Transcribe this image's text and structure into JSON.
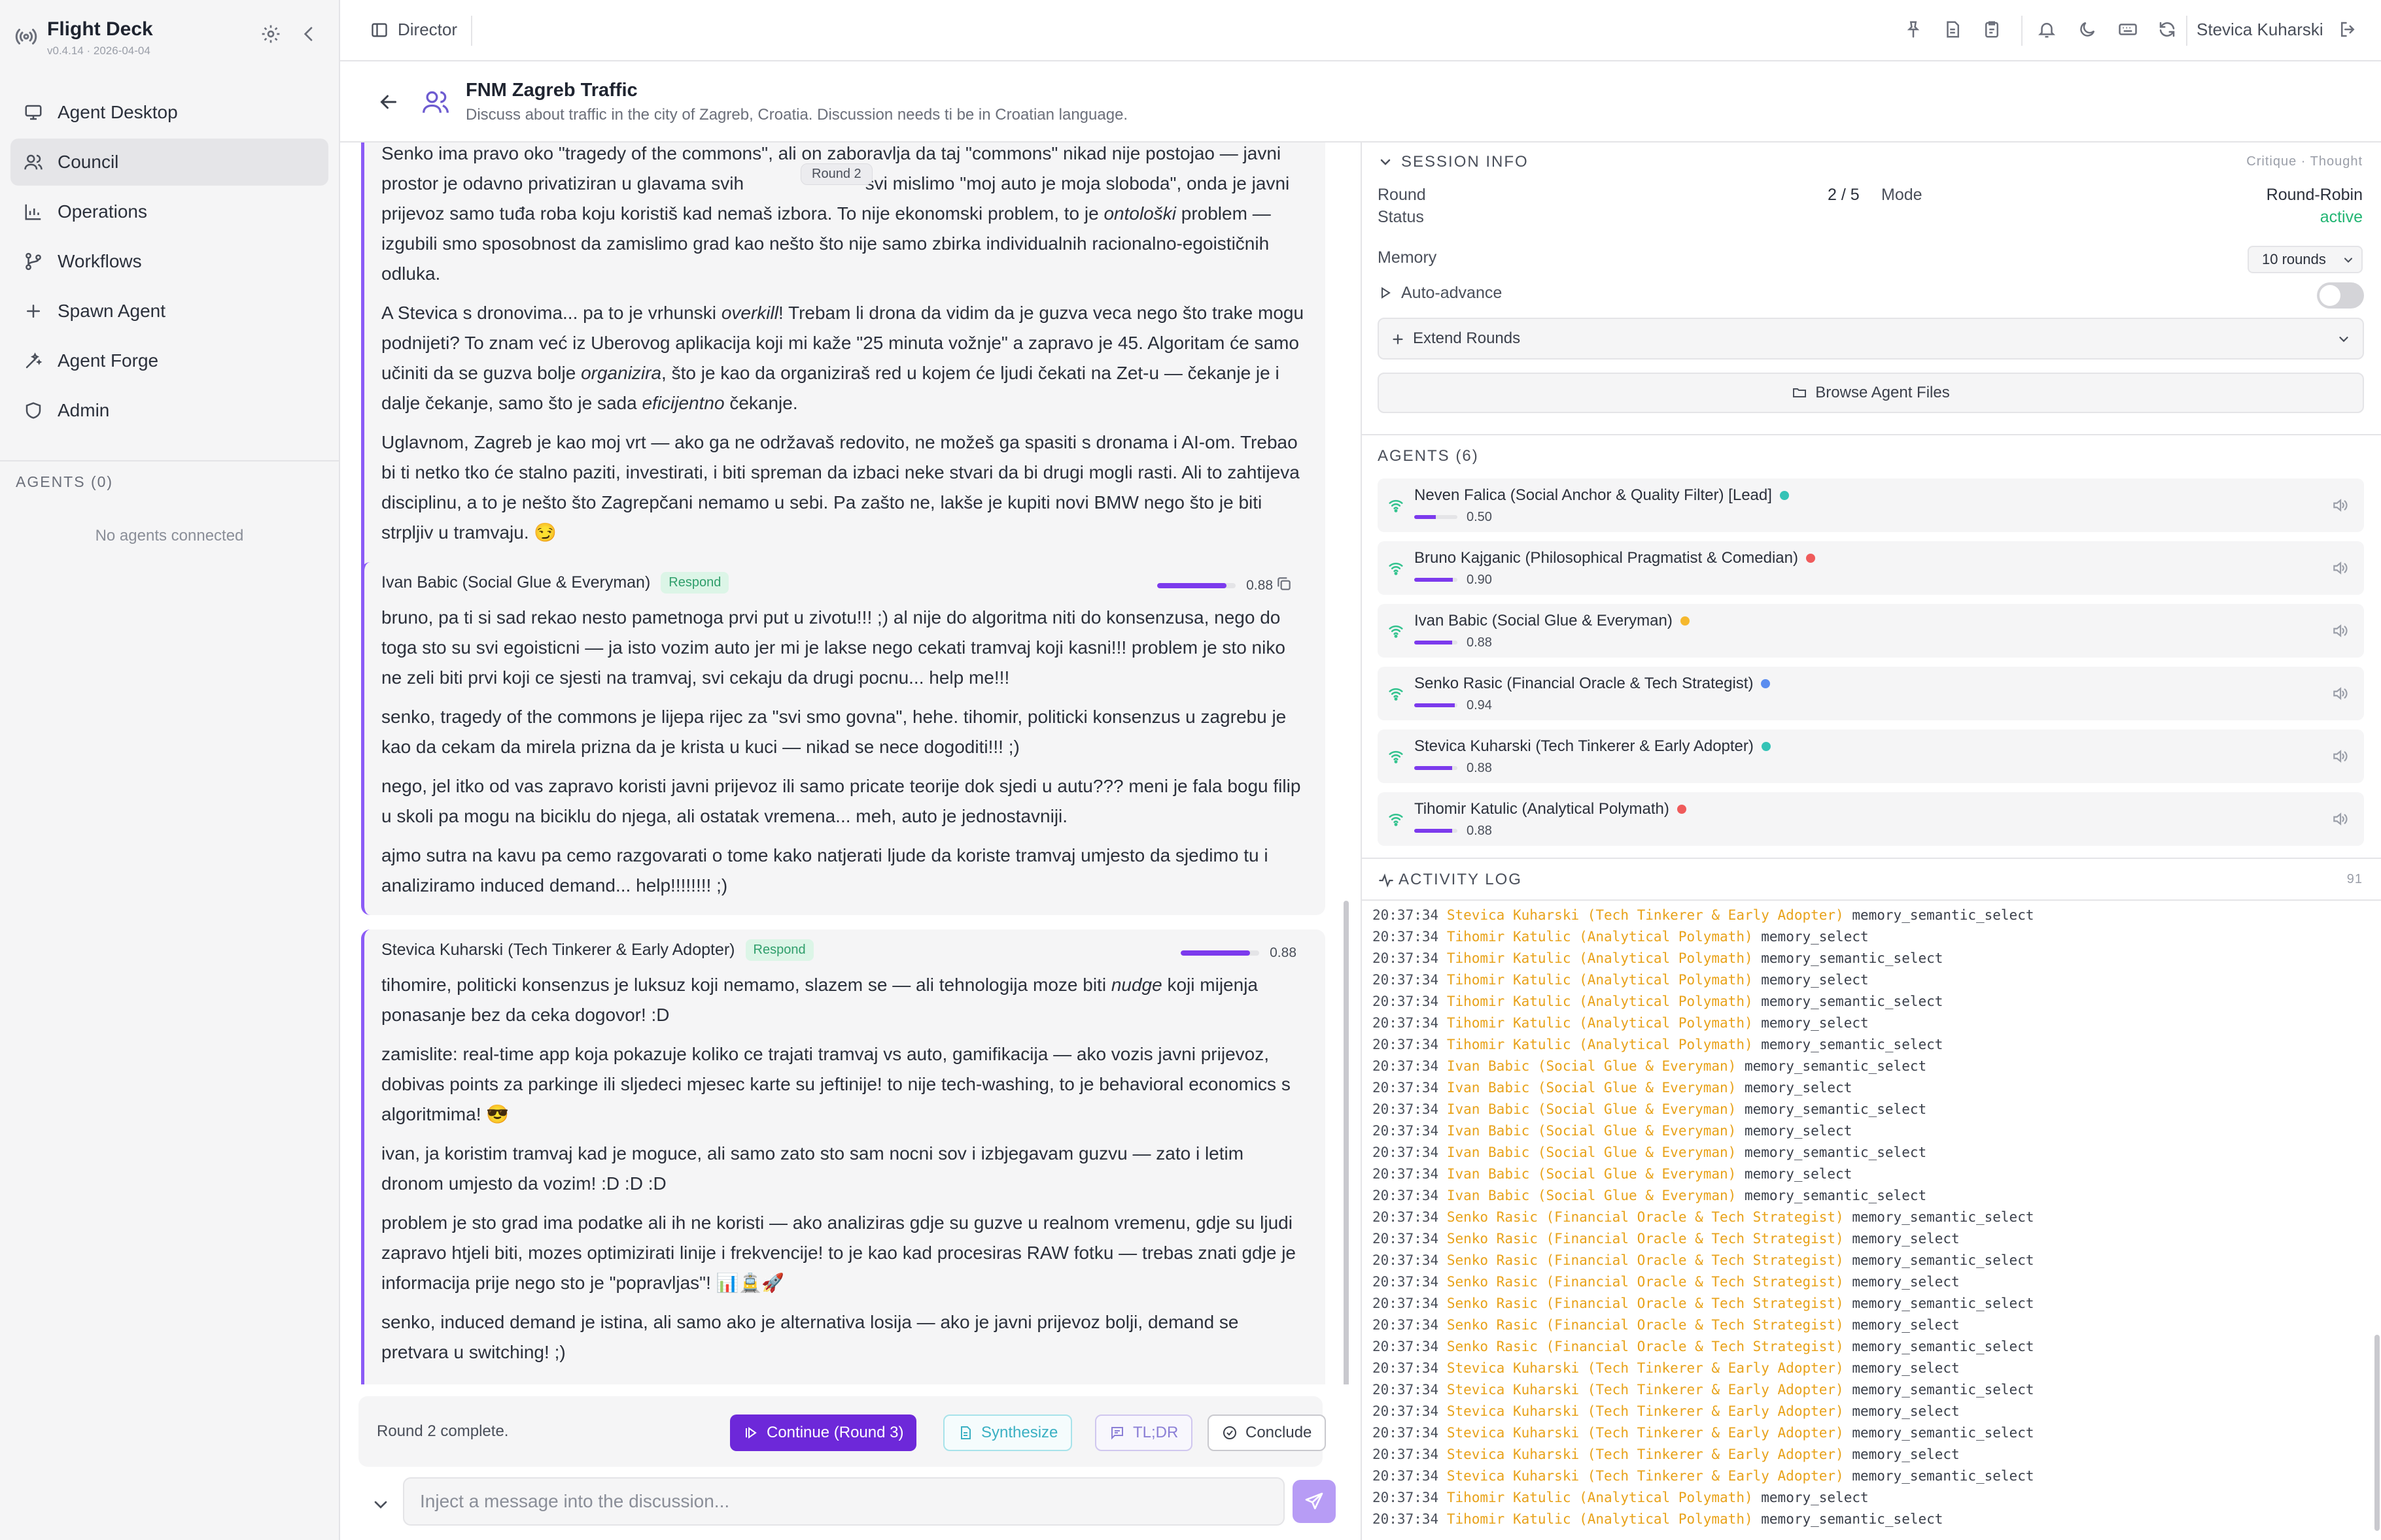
{
  "sidebar": {
    "brand": "Flight Deck",
    "version": "v0.4.14 · 2026-04-04",
    "nav": [
      {
        "label": "Agent Desktop",
        "icon": "monitor-icon"
      },
      {
        "label": "Council",
        "icon": "users-icon",
        "active": true
      },
      {
        "label": "Operations",
        "icon": "bar-chart-icon"
      },
      {
        "label": "Workflows",
        "icon": "workflow-icon"
      },
      {
        "label": "Spawn Agent",
        "icon": "plus-icon"
      },
      {
        "label": "Agent Forge",
        "icon": "wand-icon"
      },
      {
        "label": "Admin",
        "icon": "shield-icon"
      }
    ],
    "agents_header": "AGENTS (0)",
    "no_agents": "No agents connected"
  },
  "topbar": {
    "director": "Director",
    "user": "Stevica Kuharski"
  },
  "council": {
    "title": "FNM Zagreb Traffic",
    "description": "Discuss about traffic in the city of Zagreb, Croatia. Discussion needs ti be in Croatian language."
  },
  "messages": {
    "round_pill": "Round 2",
    "m1": {
      "p1a": "Senko ima pravo oko \"tragedy of the commons\", ali on zaboravlja da taj \"commons\" nikad nije postojao —",
      "p1b": "javni prostor je odavno privatiziran u glavama svih",
      "p1c": "svi mislimo \"moj auto je moja sloboda\", onda je",
      "p1d": "javni prijevoz samo tuđa roba koju koristiš kad nemaš izbora. To nije ekonomski problem, to je",
      "p1e": "ontološki",
      "p1f": "problem — izgubili smo sposobnost da zamislimo grad kao nešto što nije samo zbirka individualnih racionalno-egoističnih odluka.",
      "p2a": "A Stevica s dronovima... pa to je vrhunski",
      "p2b": "overkill",
      "p2c": "! Trebam li drona da vidim da je guzva veca nego što trake mogu podnijeti? To znam već iz Uberovog aplikacija koji mi kaže \"25 minuta vožnje\" a zapravo je 45. Algoritam će samo učiniti da se guzva bolje",
      "p2d": "organizira",
      "p2e": ", što je kao da organiziraš red u kojem će ljudi čekati na Zet-u — čekanje je i dalje čekanje, samo što je sada",
      "p2f": "eficijentno",
      "p2g": "čekanje.",
      "p3": "Uglavnom, Zagreb je kao moj vrt — ako ga ne održavaš redovito, ne možeš ga spasiti s dronama i AI-om. Trebao bi ti netko tko će stalno paziti, investirati, i biti spreman da izbaci neke stvari da bi drugi mogli rasti. Ali to zahtijeva disciplinu, a to je nešto što Zagrepčani nemamo u sebi. Pa zašto ne, lakše je kupiti novi BMW nego što je biti strpljiv u tramvaju. 😏"
    },
    "m2": {
      "author": "Ivan Babic (Social Glue & Everyman)",
      "tag": "Respond",
      "confidence": 0.88,
      "confidence_label": "0.88",
      "p1": "bruno, pa ti si sad rekao nesto pametnoga prvi put u zivotu!!! ;) al nije do algoritma niti do konsenzusa, nego do toga sto su svi egoisticni — ja isto vozim auto jer mi je lakse nego cekati tramvaj koji kasni!!! problem je sto niko ne zeli biti prvi koji ce sjesti na tramvaj, svi cekaju da drugi pocnu... help me!!!",
      "p2": "senko, tragedy of the commons je lijepa rijec za \"svi smo govna\", hehe. tihomir, politicki konsenzus u zagrebu je kao da cekam da mirela prizna da je krista u kuci — nikad se nece dogoditi!!! ;)",
      "p3": "nego, jel itko od vas zapravo koristi javni prijevoz ili samo pricate teorije dok sjedi u autu??? meni je fala bogu filip u skoli pa mogu na biciklu do njega, ali ostatak vremena... meh, auto je jednostavniji.",
      "p4": "ajmo sutra na kavu pa cemo razgovarati o tome kako natjerati ljude da koriste tramvaj umjesto da sjedimo tu i analiziramo induced demand... help!!!!!!!! ;)"
    },
    "m3": {
      "author": "Stevica Kuharski (Tech Tinkerer & Early Adopter)",
      "tag": "Respond",
      "confidence": 0.88,
      "confidence_label": "0.88",
      "p1a": "tihomire, politicki konsenzus je luksuz koji nemamo, slazem se — ali tehnologija moze biti",
      "p1b": "nudge",
      "p1c": "koji mijenja ponasanje bez da ceka dogovor! :D",
      "p2": "zamislite: real-time app koja pokazuje koliko ce trajati tramvaj vs auto, gamifikacija — ako vozis javni prijevoz, dobivas points za parkinge ili sljedeci mjesec karte su jeftinije! to nije tech-washing, to je behavioral economics s algoritmima! 😎",
      "p3": "ivan, ja koristim tramvaj kad je moguce, ali samo zato sto sam nocni sov i izbjegavam guzvu — zato i letim dronom umjesto da vozim! :D :D :D",
      "p4": "problem je sto grad ima podatke ali ih ne koristi — ako analiziras gdje su guzve u realnom vremenu, gdje su ljudi zapravo htjeli biti, mozes optimizirati linije i frekvencije! to je kao kad procesiras RAW fotku — trebas znati gdje je informacija prije nego sto je \"popravljas\"! 📊🚊🚀",
      "p5": "senko, induced demand je istina, ali samo ako je alternativa losija — ako je javni prijevoz bolji, demand se pretvara u switching! ;)"
    }
  },
  "actionbar": {
    "status": "Round 2 complete.",
    "continue": "Continue (Round 3)",
    "synthesize": "Synthesize",
    "tldr": "TL;DR",
    "conclude": "Conclude"
  },
  "input": {
    "placeholder": "Inject a message into the discussion..."
  },
  "session": {
    "title": "SESSION INFO",
    "mode_hint": "Critique · Thought",
    "round_label": "Round",
    "round_value": "2 / 5",
    "mode_label": "Mode",
    "mode_value": "Round-Robin",
    "status_label": "Status",
    "status_value": "active",
    "memory_label": "Memory",
    "memory_value": "10 rounds",
    "auto_advance": "Auto-advance",
    "extend_rounds": "Extend Rounds",
    "browse_files": "Browse Agent Files"
  },
  "agents": {
    "title": "AGENTS (6)",
    "list": [
      {
        "name": "Neven Falica (Social Anchor & Quality Filter) [Lead]",
        "score": 0.5,
        "score_label": "0.50",
        "dot": "#34c3b6"
      },
      {
        "name": "Bruno Kajganic (Philosophical Pragmatist & Comedian)",
        "score": 0.9,
        "score_label": "0.90",
        "dot": "#ef5b5b"
      },
      {
        "name": "Ivan Babic (Social Glue & Everyman)",
        "score": 0.88,
        "score_label": "0.88",
        "dot": "#f5b82e"
      },
      {
        "name": "Senko Rasic (Financial Oracle & Tech Strategist)",
        "score": 0.94,
        "score_label": "0.94",
        "dot": "#5b8def"
      },
      {
        "name": "Stevica Kuharski (Tech Tinkerer & Early Adopter)",
        "score": 0.88,
        "score_label": "0.88",
        "dot": "#34c3b6"
      },
      {
        "name": "Tihomir Katulic (Analytical Polymath)",
        "score": 0.88,
        "score_label": "0.88",
        "dot": "#ef5b5b"
      }
    ]
  },
  "activity": {
    "title": "ACTIVITY LOG",
    "count": "91",
    "lines": [
      {
        "t": "20:37:34",
        "who": "Stevica Kuharski (Tech Tinkerer & Early Adopter)",
        "op": "memory_semantic_select"
      },
      {
        "t": "20:37:34",
        "who": "Tihomir Katulic (Analytical Polymath)",
        "op": "memory_select"
      },
      {
        "t": "20:37:34",
        "who": "Tihomir Katulic (Analytical Polymath)",
        "op": "memory_semantic_select"
      },
      {
        "t": "20:37:34",
        "who": "Tihomir Katulic (Analytical Polymath)",
        "op": "memory_select"
      },
      {
        "t": "20:37:34",
        "who": "Tihomir Katulic (Analytical Polymath)",
        "op": "memory_semantic_select"
      },
      {
        "t": "20:37:34",
        "who": "Tihomir Katulic (Analytical Polymath)",
        "op": "memory_select"
      },
      {
        "t": "20:37:34",
        "who": "Tihomir Katulic (Analytical Polymath)",
        "op": "memory_semantic_select"
      },
      {
        "t": "20:37:34",
        "who": "Ivan Babic (Social Glue & Everyman)",
        "op": "memory_semantic_select"
      },
      {
        "t": "20:37:34",
        "who": "Ivan Babic (Social Glue & Everyman)",
        "op": "memory_select"
      },
      {
        "t": "20:37:34",
        "who": "Ivan Babic (Social Glue & Everyman)",
        "op": "memory_semantic_select"
      },
      {
        "t": "20:37:34",
        "who": "Ivan Babic (Social Glue & Everyman)",
        "op": "memory_select"
      },
      {
        "t": "20:37:34",
        "who": "Ivan Babic (Social Glue & Everyman)",
        "op": "memory_semantic_select"
      },
      {
        "t": "20:37:34",
        "who": "Ivan Babic (Social Glue & Everyman)",
        "op": "memory_select"
      },
      {
        "t": "20:37:34",
        "who": "Ivan Babic (Social Glue & Everyman)",
        "op": "memory_semantic_select"
      },
      {
        "t": "20:37:34",
        "who": "Senko Rasic (Financial Oracle & Tech Strategist)",
        "op": "memory_semantic_select"
      },
      {
        "t": "20:37:34",
        "who": "Senko Rasic (Financial Oracle & Tech Strategist)",
        "op": "memory_select"
      },
      {
        "t": "20:37:34",
        "who": "Senko Rasic (Financial Oracle & Tech Strategist)",
        "op": "memory_semantic_select"
      },
      {
        "t": "20:37:34",
        "who": "Senko Rasic (Financial Oracle & Tech Strategist)",
        "op": "memory_select"
      },
      {
        "t": "20:37:34",
        "who": "Senko Rasic (Financial Oracle & Tech Strategist)",
        "op": "memory_semantic_select"
      },
      {
        "t": "20:37:34",
        "who": "Senko Rasic (Financial Oracle & Tech Strategist)",
        "op": "memory_select"
      },
      {
        "t": "20:37:34",
        "who": "Senko Rasic (Financial Oracle & Tech Strategist)",
        "op": "memory_semantic_select"
      },
      {
        "t": "20:37:34",
        "who": "Stevica Kuharski (Tech Tinkerer & Early Adopter)",
        "op": "memory_select"
      },
      {
        "t": "20:37:34",
        "who": "Stevica Kuharski (Tech Tinkerer & Early Adopter)",
        "op": "memory_semantic_select"
      },
      {
        "t": "20:37:34",
        "who": "Stevica Kuharski (Tech Tinkerer & Early Adopter)",
        "op": "memory_select"
      },
      {
        "t": "20:37:34",
        "who": "Stevica Kuharski (Tech Tinkerer & Early Adopter)",
        "op": "memory_semantic_select"
      },
      {
        "t": "20:37:34",
        "who": "Stevica Kuharski (Tech Tinkerer & Early Adopter)",
        "op": "memory_select"
      },
      {
        "t": "20:37:34",
        "who": "Stevica Kuharski (Tech Tinkerer & Early Adopter)",
        "op": "memory_semantic_select"
      },
      {
        "t": "20:37:34",
        "who": "Tihomir Katulic (Analytical Polymath)",
        "op": "memory_select"
      },
      {
        "t": "20:37:34",
        "who": "Tihomir Katulic (Analytical Polymath)",
        "op": "memory_semantic_select"
      }
    ]
  }
}
